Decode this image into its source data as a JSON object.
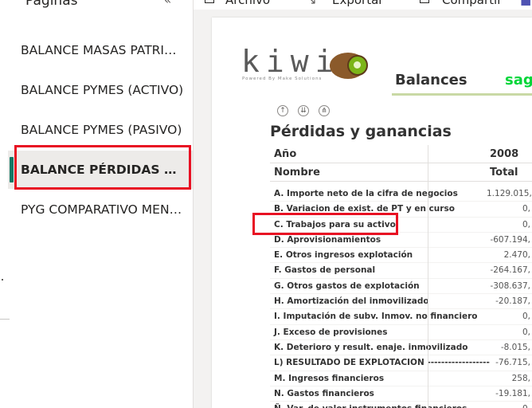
{
  "sidebar": {
    "title": "Páginas",
    "collapse_glyph": "«",
    "items": [
      {
        "label": "BALANCE MASAS PATRIMONIALES"
      },
      {
        "label": "BALANCE PYMES (ACTIVO)"
      },
      {
        "label": "BALANCE PYMES (PASIVO)"
      },
      {
        "label": "BALANCE PÉRDIDAS Y GANANCIAS"
      },
      {
        "label": "PYG COMPARATIVO MENSUAL"
      }
    ],
    "active_index": 3,
    "active_color": "#117865"
  },
  "toolbar": {
    "archivo": "Archivo",
    "exportar": "Exportar",
    "compartir": "Compartir"
  },
  "report": {
    "logo_text": "kiwi",
    "logo_subtitle": "Powered By Make Solutions",
    "header_title": "Balances",
    "brand": "sag",
    "brand_color": "#00d639",
    "drill_icons": [
      "arrow-up-icon",
      "double-arrow-down-icon",
      "expand-hierarchy-icon"
    ],
    "table_title": "Pérdidas y ganancias",
    "col_year_label": "Año",
    "col_year_value": "2008",
    "col_name_label": "Nombre",
    "col_total_label": "Total",
    "rows": [
      {
        "name": "A. Importe neto de la cifra de negocios",
        "value": "1.129.015,"
      },
      {
        "name": "B. Variacion de exist. de PT y en curso",
        "value": "0,"
      },
      {
        "name": "C. Trabajos para su activo",
        "value": "0,"
      },
      {
        "name": "D. Aprovisionamientos",
        "value": "-607.194,"
      },
      {
        "name": "E. Otros ingresos explotación",
        "value": "2.470,"
      },
      {
        "name": "F. Gastos de personal",
        "value": "-264.167,"
      },
      {
        "name": "G. Otros gastos de explotación",
        "value": "-308.637,"
      },
      {
        "name": "H. Amortización del inmovilizado",
        "value": "-20.187,"
      },
      {
        "name": "I. Imputación de subv. Inmov. no financiero",
        "value": "0,"
      },
      {
        "name": "J. Exceso de provisiones",
        "value": "0,"
      },
      {
        "name": "K. Deterioro y result. enaje. inmovilizado",
        "value": "-8.015,"
      },
      {
        "name": "L) RESULTADO DE EXPLOTACION ------------------",
        "value": "-76.715,"
      },
      {
        "name": "M. Ingresos financieros",
        "value": "258,"
      },
      {
        "name": "N. Gastos financieros",
        "value": "-19.181,"
      },
      {
        "name": "Ñ. Var. de valor instrumentos financieros",
        "value": "0,"
      }
    ]
  },
  "highlight_color": "#e81123"
}
